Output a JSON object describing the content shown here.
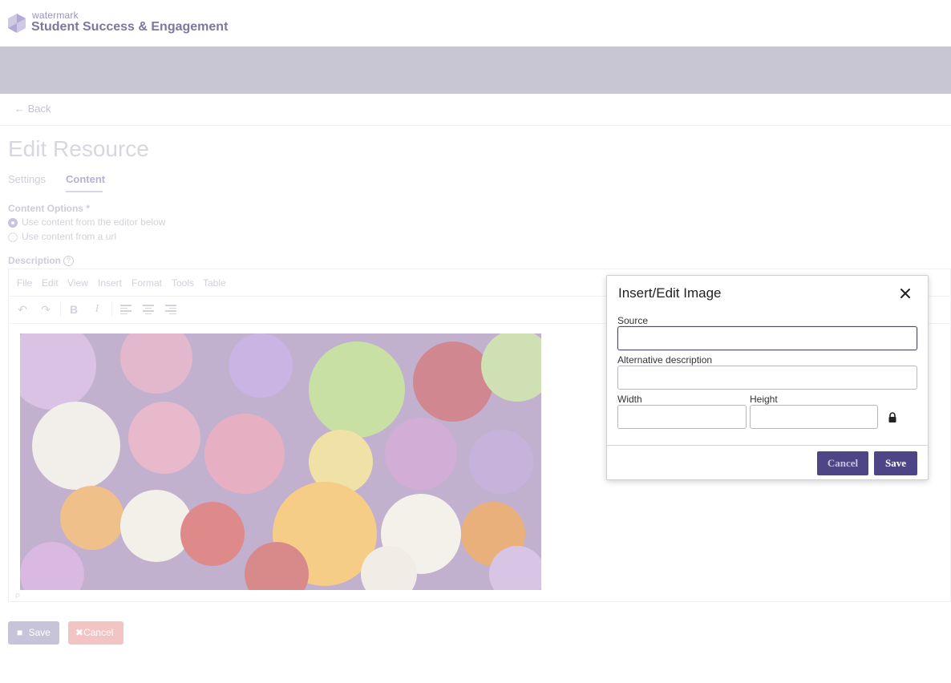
{
  "header": {
    "logo_small": "watermark",
    "logo_title": "Student Success & Engagement"
  },
  "nav": {
    "back_label": "Back"
  },
  "page": {
    "title": "Edit Resource",
    "tabs": [
      {
        "label": "Settings",
        "active": false
      },
      {
        "label": "Content",
        "active": true
      }
    ]
  },
  "content_options": {
    "label": "Content Options *",
    "options": [
      {
        "label": "Use content from the editor below",
        "selected": true
      },
      {
        "label": "Use content from a url",
        "selected": false
      }
    ]
  },
  "description": {
    "label": "Description",
    "menu": [
      "File",
      "Edit",
      "View",
      "Insert",
      "Format",
      "Tools",
      "Table"
    ],
    "status_path": "P"
  },
  "form_buttons": {
    "save": "Save",
    "cancel": "Cancel"
  },
  "modal": {
    "title": "Insert/Edit Image",
    "fields": {
      "source_label": "Source",
      "source_value": "",
      "alt_label": "Alternative description",
      "alt_value": "",
      "width_label": "Width",
      "width_value": "",
      "height_label": "Height",
      "height_value": ""
    },
    "cancel_label": "Cancel",
    "save_label": "Save"
  },
  "colors": {
    "brand": "#4e4586",
    "banner": "#c9c6d3"
  },
  "icons": [
    "watermark-logo-icon",
    "arrow-left-icon",
    "help-circle-icon",
    "undo-icon",
    "redo-icon",
    "bold-icon",
    "italic-icon",
    "align-left-icon",
    "align-center-icon",
    "align-right-icon",
    "close-icon",
    "lock-icon",
    "save-icon",
    "times-icon"
  ]
}
